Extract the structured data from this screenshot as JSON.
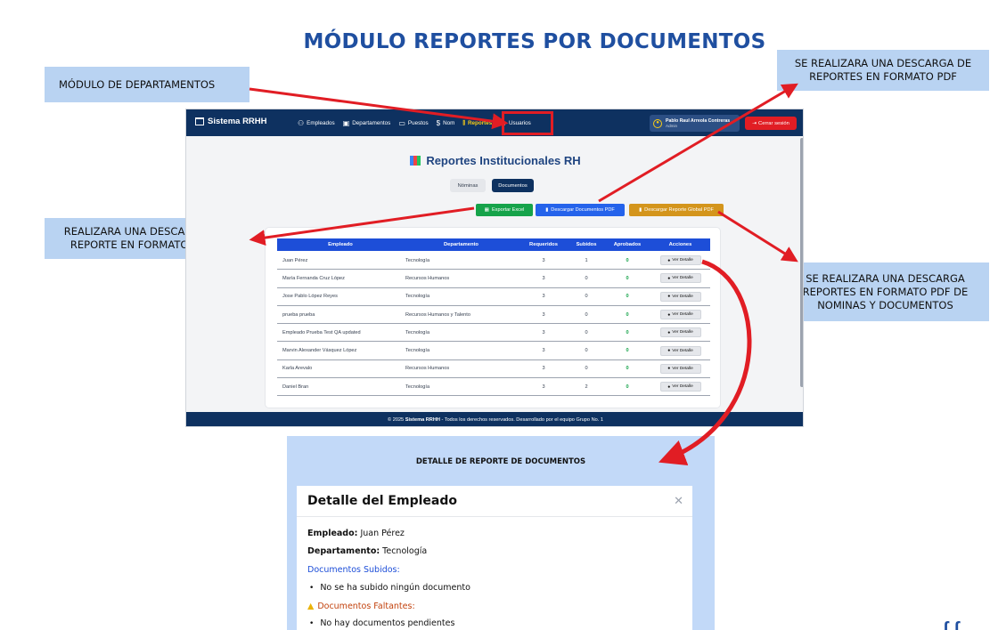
{
  "slide": {
    "title": "MÓDULO REPORTES POR DOCUMENTOS",
    "callouts": {
      "departamentos": "MÓDULO DE DEPARTAMENTOS",
      "pdf_docs": "SE REALIZARA UNA DESCARGA DE REPORTES EN FORMATO PDF",
      "excel": "REALIZARA UNA DESCARGA DEL REPORTE EN FORMATO EXCEL",
      "pdf_global": "SE REALIZARA UNA DESCARGA REPORTES EN FORMATO PDF DE NOMINAS Y DOCUMENTOS"
    },
    "colors": {
      "arrow": "#e11d24",
      "callout_bg": "#b9d3f2",
      "title": "#1f4fa0"
    }
  },
  "app": {
    "brand": "Sistema RRHH",
    "nav": [
      {
        "label": "Empleados",
        "icon": "users-icon"
      },
      {
        "label": "Departamentos",
        "icon": "building-icon"
      },
      {
        "label": "Puestos",
        "icon": "briefcase-icon"
      },
      {
        "label": "Nom",
        "icon": "dollar-icon"
      },
      {
        "label": "Reportes",
        "icon": "chart-icon"
      },
      {
        "label": "Usuarios",
        "icon": "user-check-icon"
      }
    ],
    "user": {
      "name": "Pablo Raul Arreola Contreras",
      "role": "Admin"
    },
    "logout": "Cerrar sesión",
    "page_title": "Reportes Institucionales RH",
    "tabs": {
      "nominas": "Nóminas",
      "documentos": "Documentos"
    },
    "buttons": {
      "excel": "Exportar Excel",
      "pdf_docs": "Descargar Documentos PDF",
      "pdf_global": "Descargar Reporte Global PDF"
    },
    "table": {
      "headers": {
        "empleado": "Empleado",
        "departamento": "Departamento",
        "requeridos": "Requeridos",
        "subidos": "Subidos",
        "aprobados": "Aprobados",
        "acciones": "Acciones"
      },
      "detail_label": "Ver Detalle",
      "rows": [
        {
          "empleado": "Juan Pérez",
          "departamento": "Tecnología",
          "requeridos": "3",
          "subidos": "1",
          "aprobados": "0"
        },
        {
          "empleado": "María Fernanda Cruz López",
          "departamento": "Recursos Humanos",
          "requeridos": "3",
          "subidos": "0",
          "aprobados": "0"
        },
        {
          "empleado": "Jose Pablo López Reyes",
          "departamento": "Tecnología",
          "requeridos": "3",
          "subidos": "0",
          "aprobados": "0"
        },
        {
          "empleado": "prueba prueba",
          "departamento": "Recursos Humanos y Talento",
          "requeridos": "3",
          "subidos": "0",
          "aprobados": "0"
        },
        {
          "empleado": "Empleado Prueba Test QA updated",
          "departamento": "Tecnología",
          "requeridos": "3",
          "subidos": "0",
          "aprobados": "0"
        },
        {
          "empleado": "Marvin Alexander Vásquez López",
          "departamento": "Tecnología",
          "requeridos": "3",
          "subidos": "0",
          "aprobados": "0"
        },
        {
          "empleado": "Karla Arevalo",
          "departamento": "Recursos Humanos",
          "requeridos": "3",
          "subidos": "0",
          "aprobados": "0"
        },
        {
          "empleado": "Daniel Bran",
          "departamento": "Tecnología",
          "requeridos": "3",
          "subidos": "2",
          "aprobados": "0"
        }
      ]
    },
    "footer": {
      "prefix": "© 2025 ",
      "brand": "Sistema RRHH",
      "suffix": " - Todos los derechos reservados. Desarrollado por el equipo Grupo No. 1"
    }
  },
  "detail": {
    "panel_title": "DETALLE DE REPORTE DE DOCUMENTOS",
    "modal_title": "Detalle del Empleado",
    "empleado_label": "Empleado:",
    "empleado_value": " Juan Pérez",
    "departamento_label": "Departamento:",
    "departamento_value": " Tecnología",
    "subidos_heading": "Documentos Subidos:",
    "subidos_item": "No se ha subido ningún documento",
    "faltantes_heading": "Documentos Faltantes:",
    "faltantes_item": "No hay documentos pendientes"
  }
}
